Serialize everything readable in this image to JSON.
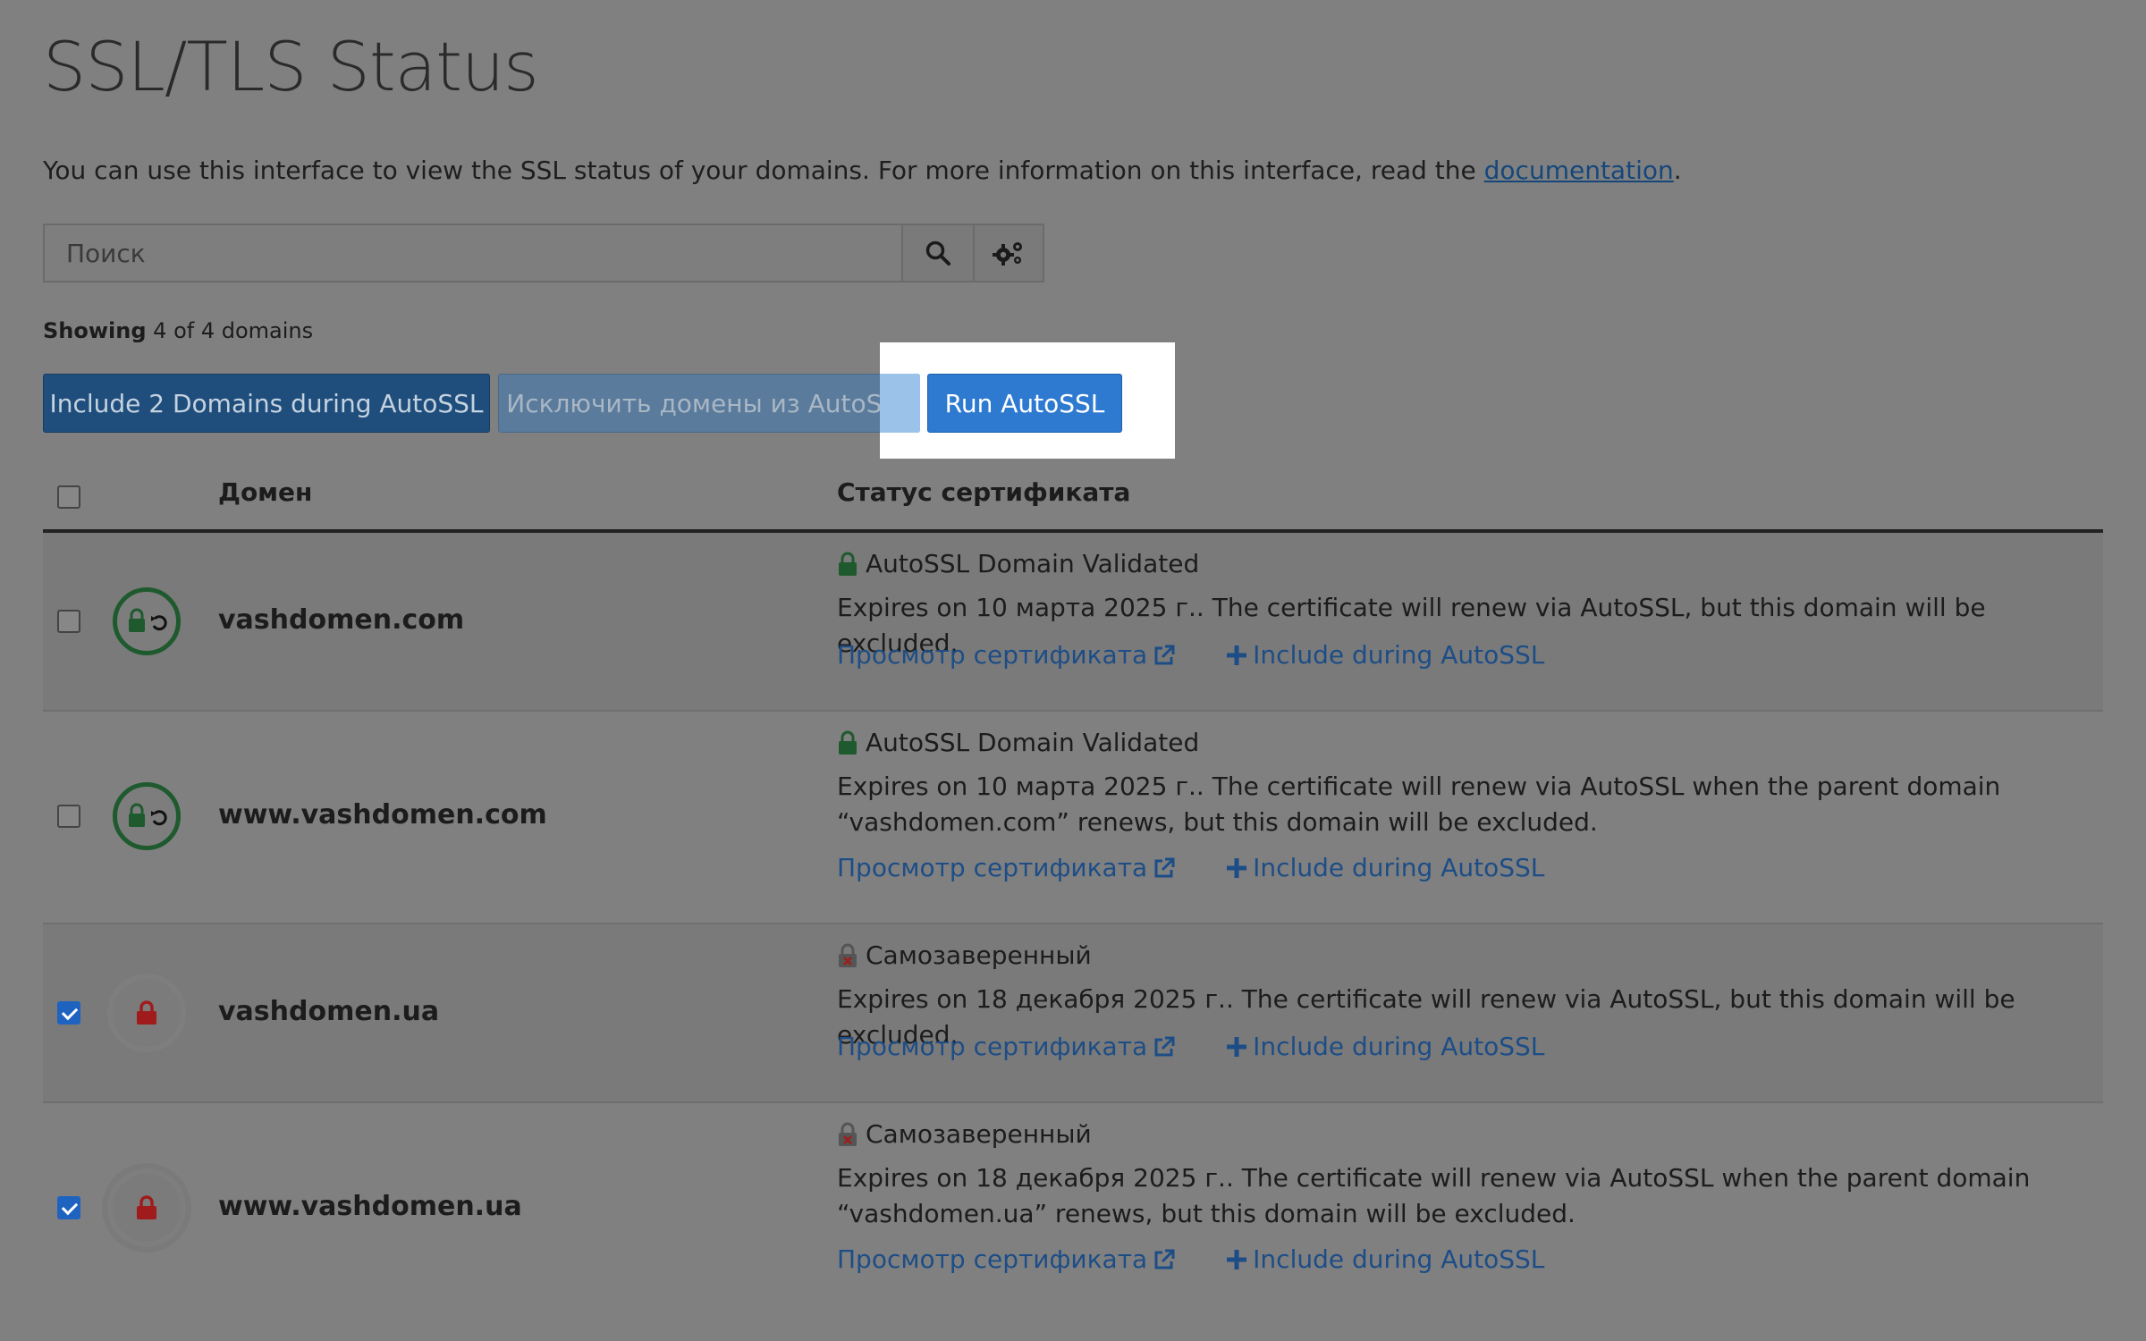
{
  "page": {
    "title": "SSL/TLS Status",
    "intro_text": "You can use this interface to view the SSL status of your domains. For more information on this interface, read the ",
    "intro_link": "documentation",
    "intro_end": "."
  },
  "search": {
    "placeholder": "Поиск"
  },
  "summary": {
    "label": "Showing",
    "count_text": "4 of 4 domains"
  },
  "actions": {
    "include_label": "Include 2 Domains during AutoSSL",
    "exclude_label": "Исключить домены из AutoSSL",
    "run_label": "Run AutoSSL"
  },
  "table": {
    "col_domain": "Домен",
    "col_status": "Статус сертификата",
    "view_link": "Просмотр сертификата",
    "include_link": "Include during AutoSSL",
    "rows": [
      {
        "domain": "vashdomen.com",
        "checked": false,
        "cert_type": "AutoSSL Domain Validated",
        "desc": "Expires on 10 марта 2025 г.. The certificate will renew via AutoSSL, but this domain will be excluded."
      },
      {
        "domain": "www.vashdomen.com",
        "checked": false,
        "cert_type": "AutoSSL Domain Validated",
        "desc": "Expires on 10 марта 2025 г.. The certificate will renew via AutoSSL when the parent domain “vashdomen.com” renews, but this domain will be excluded."
      },
      {
        "domain": "vashdomen.ua",
        "checked": true,
        "cert_type": "Самозаверенный",
        "desc": "Expires on 18 декабря 2025 г.. The certificate will renew via AutoSSL, but this domain will be excluded."
      },
      {
        "domain": "www.vashdomen.ua",
        "checked": true,
        "cert_type": "Самозаверенный",
        "desc": "Expires on 18 декабря 2025 г.. The certificate will renew via AutoSSL when the parent domain “vashdomen.ua” renews, but this domain will be excluded."
      }
    ]
  },
  "colors": {
    "ok_green": "#1e5a2e",
    "error_red": "#a01c1c",
    "link_blue": "#1d4d86",
    "primary_blue": "#2d7ad0"
  }
}
